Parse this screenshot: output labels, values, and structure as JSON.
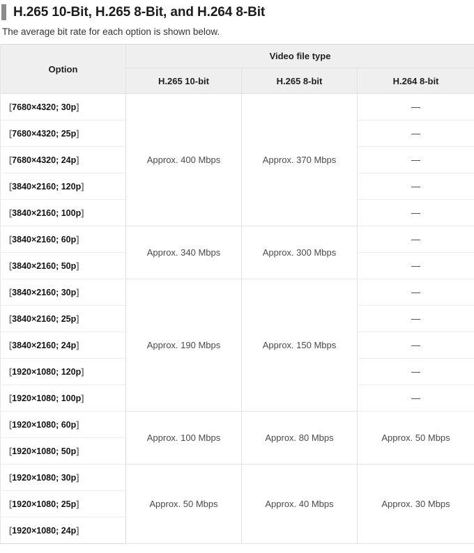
{
  "heading": {
    "title": "H.265 10-Bit, H.265 8-Bit, and H.264 8-Bit",
    "subtitle": "The average bit rate for each option is shown below.",
    "accent_color": "#8c8c8c"
  },
  "table": {
    "headers": {
      "option": "Option",
      "group": "Video file type",
      "sub": [
        "H.265 10-bit",
        "H.265 8-bit",
        "H.264 8-bit"
      ]
    },
    "options": [
      "[7680×4320; 30p]",
      "[7680×4320; 25p]",
      "[7680×4320; 24p]",
      "[3840×2160; 120p]",
      "[3840×2160; 100p]",
      "[3840×2160; 60p]",
      "[3840×2160; 50p]",
      "[3840×2160; 30p]",
      "[3840×2160; 25p]",
      "[3840×2160; 24p]",
      "[1920×1080; 120p]",
      "[1920×1080; 100p]",
      "[1920×1080; 60p]",
      "[1920×1080; 50p]",
      "[1920×1080; 30p]",
      "[1920×1080; 25p]",
      "[1920×1080; 24p]"
    ],
    "h265_10bit": [
      {
        "value": "Approx. 400 Mbps",
        "rows": 5
      },
      {
        "value": "Approx. 340 Mbps",
        "rows": 2
      },
      {
        "value": "Approx. 190 Mbps",
        "rows": 5
      },
      {
        "value": "Approx. 100 Mbps",
        "rows": 2
      },
      {
        "value": "Approx. 50 Mbps",
        "rows": 3
      }
    ],
    "h265_8bit": [
      {
        "value": "Approx. 370 Mbps",
        "rows": 5
      },
      {
        "value": "Approx. 300 Mbps",
        "rows": 2
      },
      {
        "value": "Approx. 150 Mbps",
        "rows": 5
      },
      {
        "value": "Approx. 80 Mbps",
        "rows": 2
      },
      {
        "value": "Approx. 40 Mbps",
        "rows": 3
      }
    ],
    "h264_8bit": [
      {
        "value": "—",
        "rows": 1
      },
      {
        "value": "—",
        "rows": 1
      },
      {
        "value": "—",
        "rows": 1
      },
      {
        "value": "—",
        "rows": 1
      },
      {
        "value": "—",
        "rows": 1
      },
      {
        "value": "—",
        "rows": 1
      },
      {
        "value": "—",
        "rows": 1
      },
      {
        "value": "—",
        "rows": 1
      },
      {
        "value": "—",
        "rows": 1
      },
      {
        "value": "—",
        "rows": 1
      },
      {
        "value": "—",
        "rows": 1
      },
      {
        "value": "—",
        "rows": 1
      },
      {
        "value": "Approx. 50 Mbps",
        "rows": 2
      },
      {
        "value": "Approx. 30 Mbps",
        "rows": 3
      }
    ]
  }
}
